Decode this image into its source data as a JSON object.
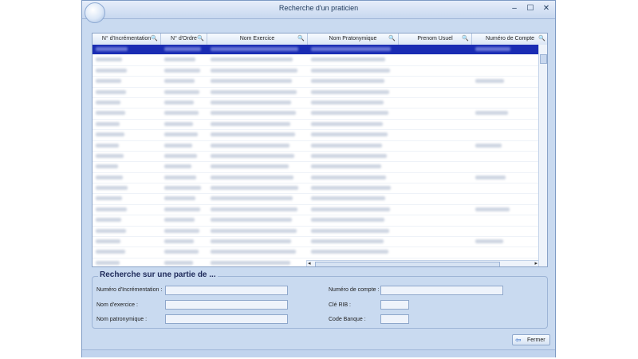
{
  "window": {
    "title": "Recherche d'un praticien",
    "controls": {
      "minimize": "‒",
      "maximize": "☐",
      "close": "✕"
    }
  },
  "grid": {
    "columns": [
      {
        "label": "N° d'Incrémentation"
      },
      {
        "label": "N° d'Ordre"
      },
      {
        "label": "Nom Exercice"
      },
      {
        "label": "Nom Pratonymique"
      },
      {
        "label": "Prenom Usuel"
      },
      {
        "label": "Numéro de Compte"
      }
    ],
    "row_count": 22,
    "selected_row": 0
  },
  "search": {
    "title": "Recherche sur une partie de ...",
    "fields": {
      "increment_label": "Numéro d'Incrémentation :",
      "exercise_label": "Nom d'exercice :",
      "patronymic_label": "Nom patronymique :",
      "account_label": "Numéro de compte :",
      "rib_label": "Clé RIB :",
      "bank_label": "Code Banque :"
    }
  },
  "actions": {
    "close_label": "Fermer"
  }
}
